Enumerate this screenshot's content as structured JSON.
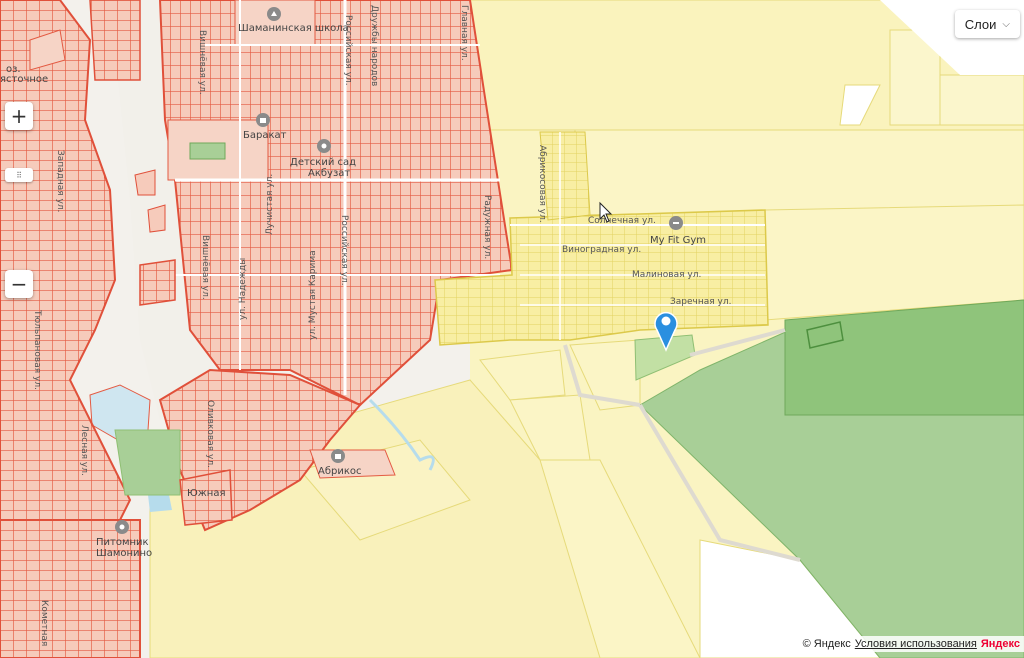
{
  "controls": {
    "layers_label": "Слои",
    "zoom_in": "+",
    "zoom_out": "−",
    "zoom_slider": "⠿"
  },
  "copyright": {
    "text": "© Яндекс",
    "terms": "Условия использования",
    "brand": "Яндекс"
  },
  "places": {
    "lake": "оз.",
    "lake2": "ясточное",
    "school": "Шаманинская школа",
    "barakat": "Баракат",
    "kindergarten1": "Детский сад",
    "kindergarten2": "Акбузат",
    "gym": "My Fit Gym",
    "abrikos": "Абрикос",
    "yuzhnaya": "Южная",
    "nursery1": "Питомник",
    "nursery2": "Шамонино"
  },
  "streets": {
    "vishnevaya": "Вишнёвая ул.",
    "vishnevaya2": "Вишнёвая ул.",
    "luchistaya": "Лучистая ул.",
    "nadezhdy": "ул. Надежды",
    "musa_karima": "ул. Мустая Карима",
    "rossiyskaya": "Российская ул.",
    "rossiyskaya2": "Российская ул.",
    "druzhby": "Дружбы народов",
    "raduzhnaya": "Радужная ул.",
    "abrikosovaya": "Абрикосовая ул.",
    "solnechnaya": "Солнечная ул.",
    "vinogradnaya": "Виноградная ул.",
    "malinovaya": "Малиновая ул.",
    "zarechnaya": "Заречная ул.",
    "olivkovaya": "Оливковая ул.",
    "tyulpanovaya": "Тюльпановая ул.",
    "lesnaya": "Лесная ул.",
    "zapadnaya": "Западная ул.",
    "kometnaya": "Кометная",
    "glavnaya": "Главная ул."
  },
  "colors": {
    "urban_fill": "#f3c3b2",
    "urban_line": "#e0503a",
    "suburb_fill": "#faf2b8",
    "suburb_line": "#e9d96a",
    "forest": "#a9cf98",
    "forest_dark": "#8fc47b",
    "water": "#b6dcec",
    "pin": "#2a8fe0"
  }
}
